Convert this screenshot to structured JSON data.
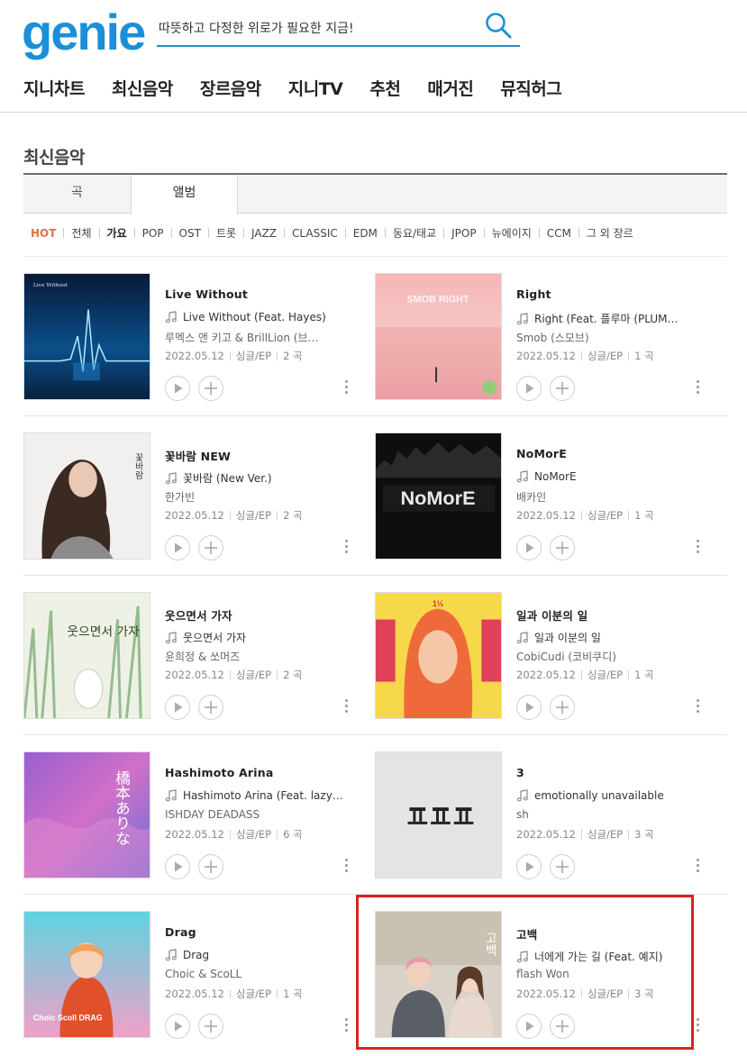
{
  "header": {
    "logo": "genie",
    "search_value": "따뜻하고 다정한 위로가 필요한 지금!",
    "nav": [
      "지니차트",
      "최신음악",
      "장르음악",
      "지니TV",
      "추천",
      "매거진",
      "뮤직허그"
    ]
  },
  "page_title": "최신음악",
  "tabs": [
    "곡",
    "앨범"
  ],
  "selected_tab": "앨범",
  "genres": [
    "HOT",
    "전체",
    "가요",
    "POP",
    "OST",
    "트롯",
    "JAZZ",
    "CLASSIC",
    "EDM",
    "동요/태교",
    "JPOP",
    "뉴에이지",
    "CCM",
    "그 외 장르"
  ],
  "selected_genre": "가요",
  "colors": {
    "brand": "#1b8fd9",
    "hot": "#e36f4b",
    "highlight": "#e02020"
  },
  "albums": [
    {
      "title": "Live Without",
      "song": "Live Without (Feat. Hayes)",
      "artist": "루멕스 앤 키고 & BrillLion (브…",
      "date": "2022.05.12",
      "type": "싱글/EP",
      "count": "2 곡",
      "cover_text": "Live Without"
    },
    {
      "title": "Right",
      "song": "Right (Feat. 플루마 (PLUM…",
      "artist": "Smob (스모브)",
      "date": "2022.05.12",
      "type": "싱글/EP",
      "count": "1 곡",
      "cover_text": "SMOB RIGHT"
    },
    {
      "title": "꽃바람 NEW",
      "song": "꽃바람 (New Ver.)",
      "artist": "한가빈",
      "date": "2022.05.12",
      "type": "싱글/EP",
      "count": "2 곡",
      "cover_text": "꽃바람"
    },
    {
      "title": "NoMorE",
      "song": "NoMorE",
      "artist": "배카인",
      "date": "2022.05.12",
      "type": "싱글/EP",
      "count": "1 곡",
      "cover_text": "NoMorE"
    },
    {
      "title": "웃으면서 가자",
      "song": "웃으면서 가자",
      "artist": "윤희정 & 쏘머즈",
      "date": "2022.05.12",
      "type": "싱글/EP",
      "count": "2 곡",
      "cover_text": "웃으면서 가자"
    },
    {
      "title": "일과 이분의 일",
      "song": "일과 이분의 일",
      "artist": "CobiCudi (코비쿠디)",
      "date": "2022.05.12",
      "type": "싱글/EP",
      "count": "1 곡",
      "cover_text": "1½"
    },
    {
      "title": "Hashimoto Arina",
      "song": "Hashimoto Arina (Feat. lazy…",
      "artist": "ISHDAY DEADASS",
      "date": "2022.05.12",
      "type": "싱글/EP",
      "count": "6 곡",
      "cover_text": "橋本ありな"
    },
    {
      "title": "3",
      "song": "emotionally unavailable",
      "artist": "sh",
      "date": "2022.05.12",
      "type": "싱글/EP",
      "count": "3 곡",
      "cover_text": ""
    },
    {
      "title": "Drag",
      "song": "Drag",
      "artist": "Choic & ScoLL",
      "date": "2022.05.12",
      "type": "싱글/EP",
      "count": "1 곡",
      "cover_text": "Choic Scoll DRAG"
    },
    {
      "title": "고백",
      "song": "너에게 가는 길 (Feat. 예지)",
      "artist": "flash Won",
      "date": "2022.05.12",
      "type": "싱글/EP",
      "count": "3 곡",
      "cover_text": "고백"
    }
  ]
}
